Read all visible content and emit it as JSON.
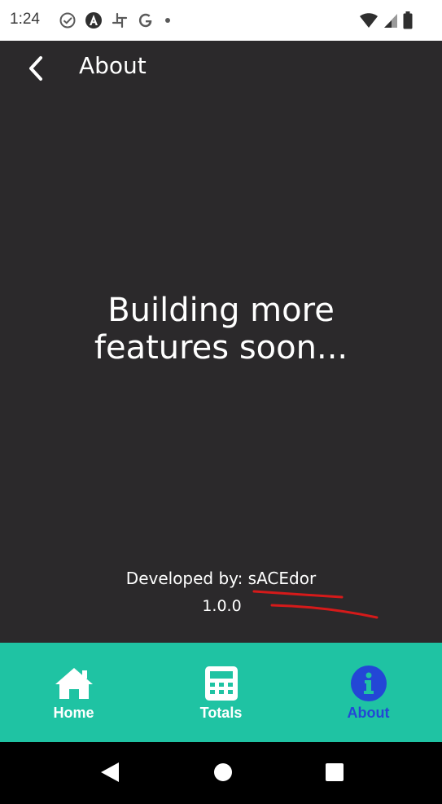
{
  "status_bar": {
    "time": "1:24",
    "icons": [
      "check-circle-icon",
      "angular-icon",
      "slack-icon",
      "google-icon",
      "dot-icon"
    ],
    "right_icons": [
      "wifi-icon",
      "signal-icon",
      "battery-icon"
    ]
  },
  "app_bar": {
    "title": "About",
    "back_icon": "chevron-left-icon"
  },
  "main": {
    "message_line1": "Building more",
    "message_line2": "features soon..."
  },
  "footer_info": {
    "developed_by_label": "Developed by:",
    "developer_name": "sACEdor",
    "version": "1.0.0"
  },
  "bottom_nav": {
    "items": [
      {
        "label": "Home",
        "icon": "home-icon",
        "active": false
      },
      {
        "label": "Totals",
        "icon": "calculator-icon",
        "active": false
      },
      {
        "label": "About",
        "icon": "info-icon",
        "active": true
      }
    ]
  },
  "colors": {
    "background": "#2b292b",
    "nav_background": "#1fc3a3",
    "active": "#2347d6",
    "annotation": "#d51a1a"
  }
}
